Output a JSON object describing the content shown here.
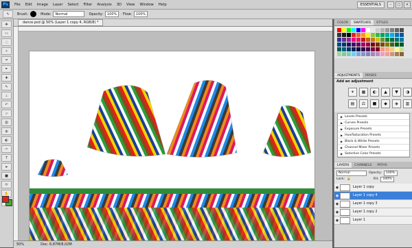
{
  "app": {
    "logo": "Ps",
    "workspace": "ESSENTIALS"
  },
  "menu": [
    "File",
    "Edit",
    "Image",
    "Layer",
    "Select",
    "Filter",
    "Analysis",
    "3D",
    "View",
    "Window",
    "Help"
  ],
  "options": {
    "brush_label": "Brush:",
    "mode_label": "Mode:",
    "mode_value": "Normal",
    "opacity_label": "Opacity:",
    "opacity_value": "100%",
    "flow_label": "Flow:",
    "flow_value": "100%"
  },
  "window_buttons": [
    "–",
    "□",
    "×"
  ],
  "document": {
    "tab_title": "dance.psd @ 50% (Layer 1 copy 4, RGB/8) *",
    "zoom": "50%",
    "doc_info": "Doc: 6,87M/8,02M"
  },
  "panels": {
    "tabs_top": [
      "COLOR",
      "SWATCHES",
      "STYLES"
    ],
    "tabs_adj": [
      "ADJUSTMENTS",
      "MASKS"
    ],
    "adj_heading": "Add an adjustment",
    "adj_icons": [
      "☀",
      "▦",
      "◐",
      "▲",
      "▼",
      "◑",
      "▤",
      "⚖",
      "■",
      "◆",
      "◈",
      "▥"
    ],
    "presets": [
      "Levels Presets",
      "Curves Presets",
      "Exposure Presets",
      "Hue/Saturation Presets",
      "Black & White Presets",
      "Channel Mixer Presets",
      "Selective Color Presets"
    ],
    "tabs_layers": [
      "LAYERS",
      "CHANNELS",
      "PATHS"
    ],
    "blend_mode": "Normal",
    "opacity_label": "Opacity:",
    "opacity_value": "100%",
    "lock_label": "Lock:",
    "fill_label": "Fill:",
    "fill_value": "100%",
    "layers": [
      {
        "name": "Layer 1 copy",
        "selected": false
      },
      {
        "name": "Layer 1 copy 4",
        "selected": true
      },
      {
        "name": "Layer 1 copy 3",
        "selected": false
      },
      {
        "name": "Layer 1 copy 2",
        "selected": false
      },
      {
        "name": "Layer 1",
        "selected": false
      }
    ]
  },
  "swatch_colors": [
    "#ff0000",
    "#ffff00",
    "#00ff00",
    "#00ffff",
    "#0000ff",
    "#ff00ff",
    "#ffffff",
    "#e6e6e6",
    "#cccccc",
    "#b3b3b3",
    "#999999",
    "#808080",
    "#666666",
    "#4d4d4d",
    "#333333",
    "#1a1a1a",
    "#000000",
    "#ee1c24",
    "#f26522",
    "#f7941d",
    "#fff200",
    "#8dc63f",
    "#39b54a",
    "#00a651",
    "#00a99d",
    "#00aeef",
    "#0072bc",
    "#0054a6",
    "#2e3192",
    "#662d91",
    "#92278f",
    "#ec008c",
    "#ed145b",
    "#c4161c",
    "#c75a1a",
    "#c77c0e",
    "#d6c100",
    "#5e9732",
    "#1a7c38",
    "#007236",
    "#00746b",
    "#0076a3",
    "#004a80",
    "#003471",
    "#1b1464",
    "#440e62",
    "#630460",
    "#9e005d",
    "#9e0039",
    "#790000",
    "#7b2e00",
    "#7d4900",
    "#827b00",
    "#406618",
    "#005e20",
    "#005826",
    "#005952",
    "#005b7f",
    "#003663",
    "#002157",
    "#0d004c",
    "#32004b",
    "#4b0049",
    "#7b0046",
    "#7a0026",
    "#f7977a",
    "#f9ad81",
    "#fdc68a",
    "#fff79a",
    "#c4df9b",
    "#a3d39c",
    "#82ca9d",
    "#7bcdc8",
    "#6ecff6",
    "#7ea7d8",
    "#8493ca",
    "#8882be",
    "#a187be",
    "#bc8dbf",
    "#f49ac2",
    "#f6989d",
    "#c69c6d",
    "#a67c52",
    "#8c6239"
  ]
}
